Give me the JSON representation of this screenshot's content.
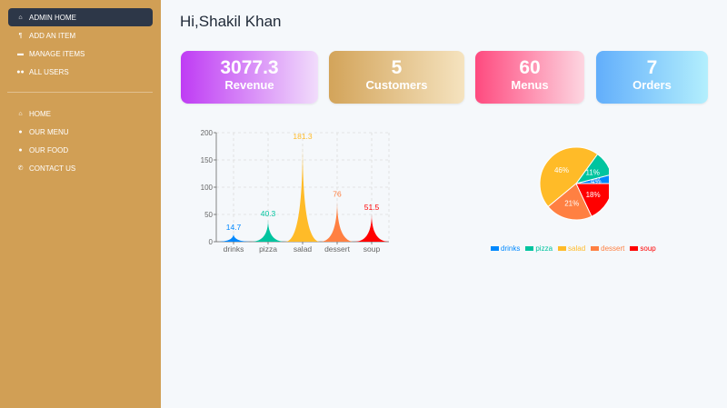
{
  "sidebar": {
    "top_items": [
      {
        "label": "ADMIN HOME",
        "icon": "home-icon"
      },
      {
        "label": "ADD AN ITEM",
        "icon": "utensils-icon"
      },
      {
        "label": "MANAGE ITEMS",
        "icon": "wallet-icon"
      },
      {
        "label": "ALL USERS",
        "icon": "users-icon"
      }
    ],
    "bottom_items": [
      {
        "label": "HOME",
        "icon": "home-icon"
      },
      {
        "label": "OUR MENU",
        "icon": "circle-icon"
      },
      {
        "label": "OUR FOOD",
        "icon": "circle-icon"
      },
      {
        "label": "CONTACT US",
        "icon": "phone-icon"
      }
    ]
  },
  "greeting": "Hi,Shakil Khan",
  "stats": {
    "revenue": {
      "value": "3077.3",
      "label": "Revenue"
    },
    "customers": {
      "value": "5",
      "label": "Customers"
    },
    "menus": {
      "value": "60",
      "label": "Menus"
    },
    "orders": {
      "value": "7",
      "label": "Orders"
    }
  },
  "chart_data": [
    {
      "type": "bar",
      "categories": [
        "drinks",
        "pizza",
        "salad",
        "dessert",
        "soup"
      ],
      "values": [
        14.7,
        40.3,
        181.3,
        76,
        51.5
      ],
      "value_labels": [
        "14.7",
        "40.3",
        "181.3",
        "76",
        "51.5"
      ],
      "colors": [
        "#0088fe",
        "#00c49f",
        "#ffbb28",
        "#ff8042",
        "#ff0000"
      ],
      "ylim": [
        0,
        200
      ],
      "yticks": [
        "0",
        "50",
        "100",
        "150",
        "200"
      ],
      "grid": true
    },
    {
      "type": "pie",
      "categories": [
        "drinks",
        "pizza",
        "salad",
        "dessert",
        "soup"
      ],
      "values": [
        4,
        11,
        46,
        21,
        18
      ],
      "labels": [
        "4%",
        "11%",
        "46%",
        "21%",
        "18%"
      ],
      "colors": [
        "#0088fe",
        "#00c49f",
        "#ffbb28",
        "#ff8042",
        "#ff0000"
      ],
      "legend": "bottom"
    }
  ]
}
